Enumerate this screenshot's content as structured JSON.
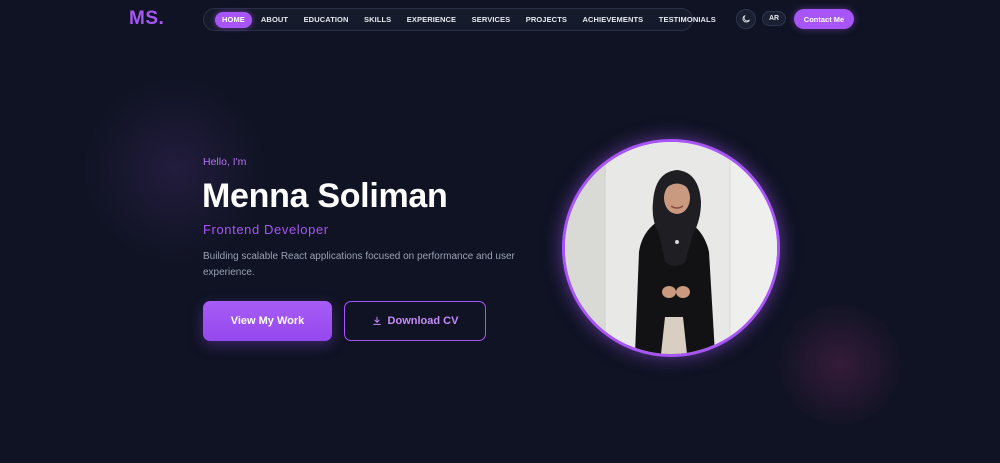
{
  "header": {
    "logo": "MS.",
    "nav": [
      {
        "label": "HOME",
        "active": true
      },
      {
        "label": "ABOUT",
        "active": false
      },
      {
        "label": "EDUCATION",
        "active": false
      },
      {
        "label": "SKILLS",
        "active": false
      },
      {
        "label": "EXPERIENCE",
        "active": false
      },
      {
        "label": "SERVICES",
        "active": false
      },
      {
        "label": "PROJECTS",
        "active": false
      },
      {
        "label": "ACHIEVEMENTS",
        "active": false
      },
      {
        "label": "TESTIMONIALS",
        "active": false
      }
    ],
    "theme_icon": "moon-icon",
    "lang_label": "AR",
    "contact_label": "Contact Me"
  },
  "hero": {
    "greeting": "Hello, I'm",
    "name": "Menna Soliman",
    "role": "Frontend Developer",
    "tagline": "Building scalable React applications focused on performance and user experience.",
    "primary_button": "View My Work",
    "secondary_button": "Download CV",
    "secondary_icon": "download-icon"
  },
  "colors": {
    "background": "#0f1323",
    "accent": "#a855f7",
    "text_muted": "#9aa0b4"
  }
}
